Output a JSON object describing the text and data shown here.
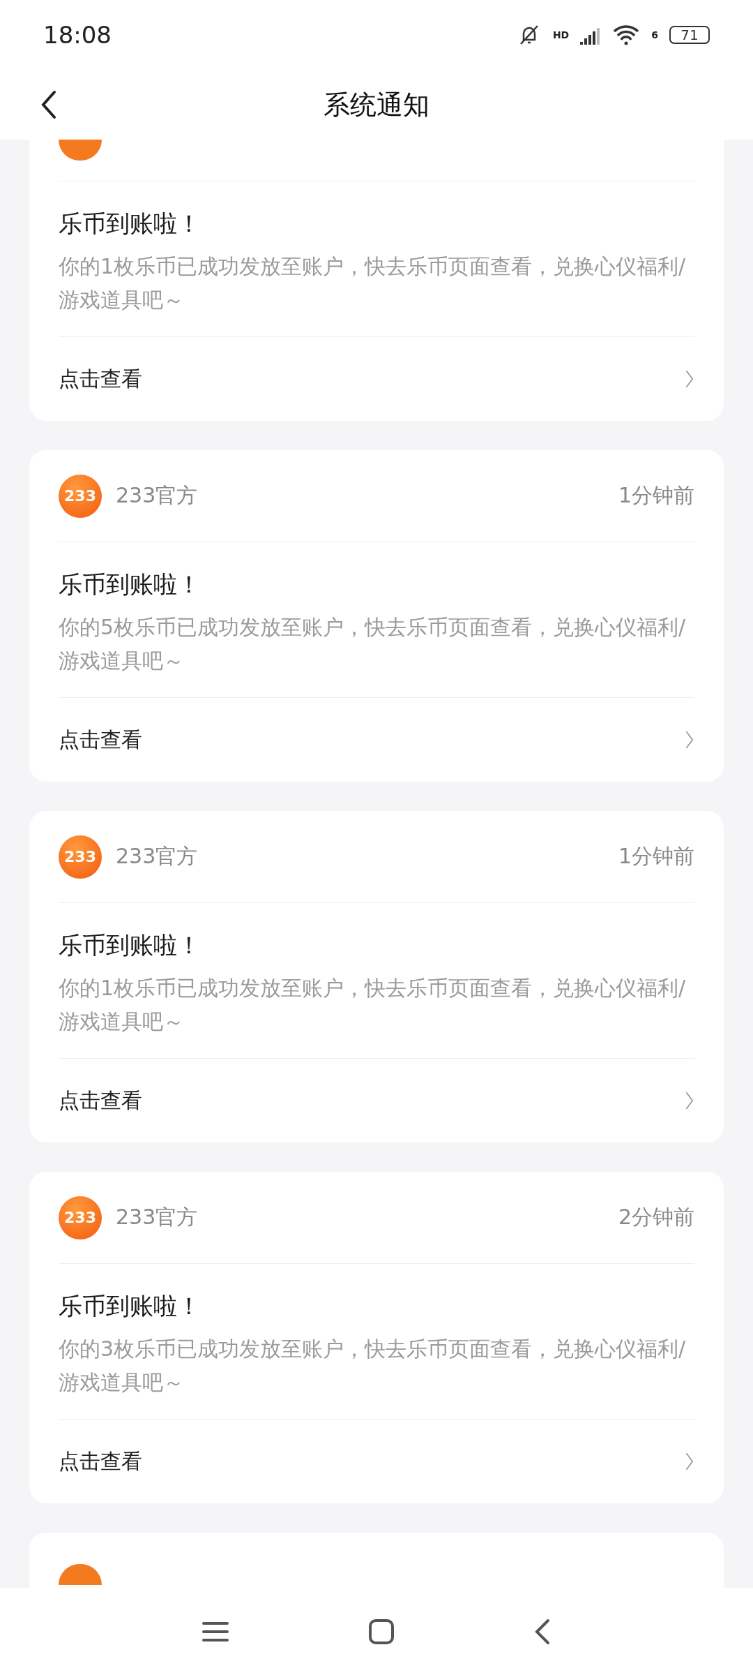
{
  "status_bar": {
    "time": "18:08",
    "network": "HD",
    "wifi_gen": "6",
    "battery": "71"
  },
  "app_bar": {
    "title": "系统通知"
  },
  "cards": [
    {
      "kind": "cut_top",
      "title": "乐币到账啦！",
      "body": "你的1枚乐币已成功发放至账户，快去乐币页面查看，兑换心仪福利/游戏道具吧～",
      "action": "点击查看"
    },
    {
      "kind": "full",
      "avatar": "233",
      "sender": "233官方",
      "time": "1分钟前",
      "title": "乐币到账啦！",
      "body": "你的5枚乐币已成功发放至账户，快去乐币页面查看，兑换心仪福利/游戏道具吧～",
      "action": "点击查看"
    },
    {
      "kind": "full",
      "avatar": "233",
      "sender": "233官方",
      "time": "1分钟前",
      "title": "乐币到账啦！",
      "body": "你的1枚乐币已成功发放至账户，快去乐币页面查看，兑换心仪福利/游戏道具吧～",
      "action": "点击查看"
    },
    {
      "kind": "full",
      "avatar": "233",
      "sender": "233官方",
      "time": "2分钟前",
      "title": "乐币到账啦！",
      "body": "你的3枚乐币已成功发放至账户，快去乐币页面查看，兑换心仪福利/游戏道具吧～",
      "action": "点击查看"
    },
    {
      "kind": "cut_bottom"
    }
  ]
}
